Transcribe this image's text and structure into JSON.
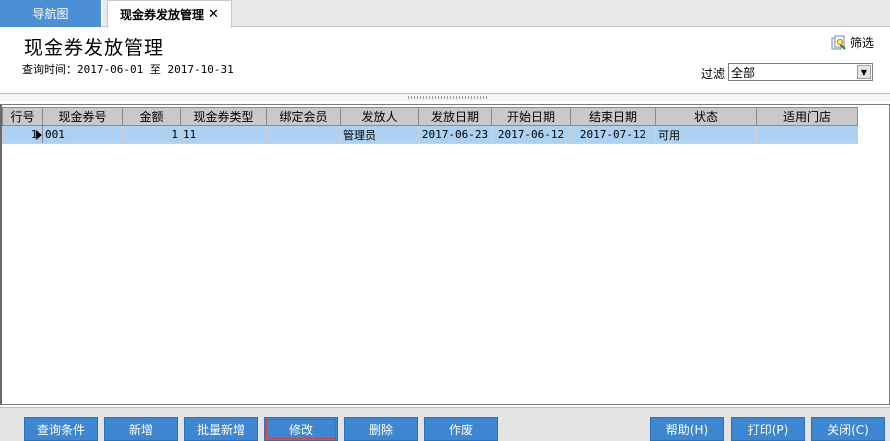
{
  "tabs": {
    "nav_label": "导航图",
    "active_label": "现金券发放管理",
    "close_glyph": "✕"
  },
  "header": {
    "title": "现金券发放管理",
    "query_label": "查询时间：",
    "date_from": "2017-06-01",
    "date_sep": "至",
    "date_to": "2017-10-31",
    "filter_link": "筛选",
    "filter_label": "过滤",
    "filter_value": "全部"
  },
  "grid": {
    "columns": [
      "行号",
      "现金券号",
      "金额",
      "现金券类型",
      "绑定会员",
      "发放人",
      "发放日期",
      "开始日期",
      "结束日期",
      "状态",
      "适用门店"
    ],
    "rows": [
      {
        "row_no": "1",
        "voucher_no": "001",
        "amount": "1",
        "voucher_type": "11",
        "member": "",
        "issuer": "管理员",
        "issue_date": "2017-06-23",
        "start_date": "2017-06-12",
        "end_date": "2017-07-12",
        "status": "可用",
        "store": ""
      }
    ]
  },
  "toolbar": {
    "query": "查询条件",
    "add": "新增",
    "batch_add": "批量新增",
    "edit": "修改",
    "delete": "删除",
    "void": "作废",
    "help": "帮助(H)",
    "print": "打印(P)",
    "close": "关闭(C)"
  },
  "colors": {
    "accent": "#3d86d2",
    "selected_row": "#acd2f3",
    "header_bg": "#c9c9c9"
  },
  "icons": {
    "filter": "filter-icon",
    "dropdown": "chevron-down-icon",
    "row_pointer": "row-pointer-icon"
  }
}
